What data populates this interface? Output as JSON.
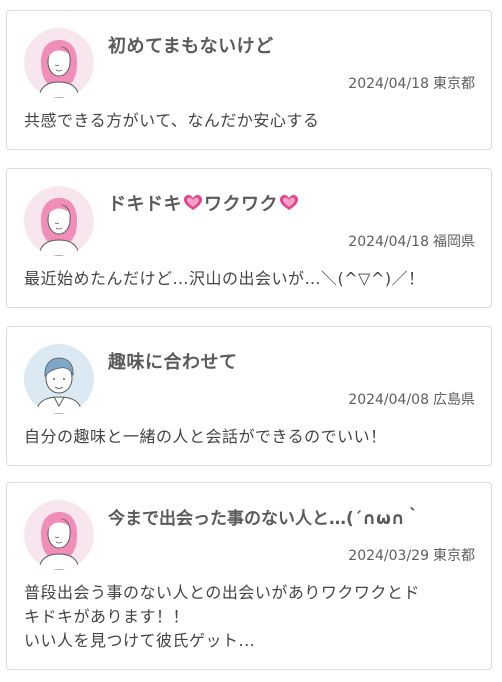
{
  "posts": [
    {
      "title": "初めてまもないけど",
      "date": "2024/04/18",
      "prefecture": "東京都",
      "avatar": "female-avatar",
      "body": [
        "共感できる方がいて、なんだか安心する"
      ]
    },
    {
      "title_parts": [
        "ドキドキ",
        "ワクワク"
      ],
      "date": "2024/04/18",
      "prefecture": "福岡県",
      "avatar": "female-avatar",
      "heart_icon": "sparkling-heart-icon",
      "body": [
        "最近始めたんだけど…沢山の出会いが…＼(^▽^)／！"
      ]
    },
    {
      "title": "趣味に合わせて",
      "date": "2024/04/08",
      "prefecture": "広島県",
      "avatar": "male-avatar",
      "body": [
        "自分の趣味と一緒の人と会話ができるのでいい！"
      ]
    },
    {
      "title": "今まで出会った事のない人と…(´∩ω∩｀",
      "date": "2024/03/29",
      "prefecture": "東京都",
      "avatar": "female-avatar",
      "body": [
        "普段出会う事のない人との出会いがありワクワクとド",
        "キドキがあります！！",
        "いい人を見つけて彼氏ゲット..."
      ]
    }
  ],
  "colors": {
    "card_border": "#dcdcdc",
    "text": "#444444",
    "female_bg": "#f8e6ef",
    "female_hair": "#f08db8",
    "male_bg": "#dbe9f3",
    "male_hair": "#7ea6c7",
    "heart": "#e8418c"
  }
}
